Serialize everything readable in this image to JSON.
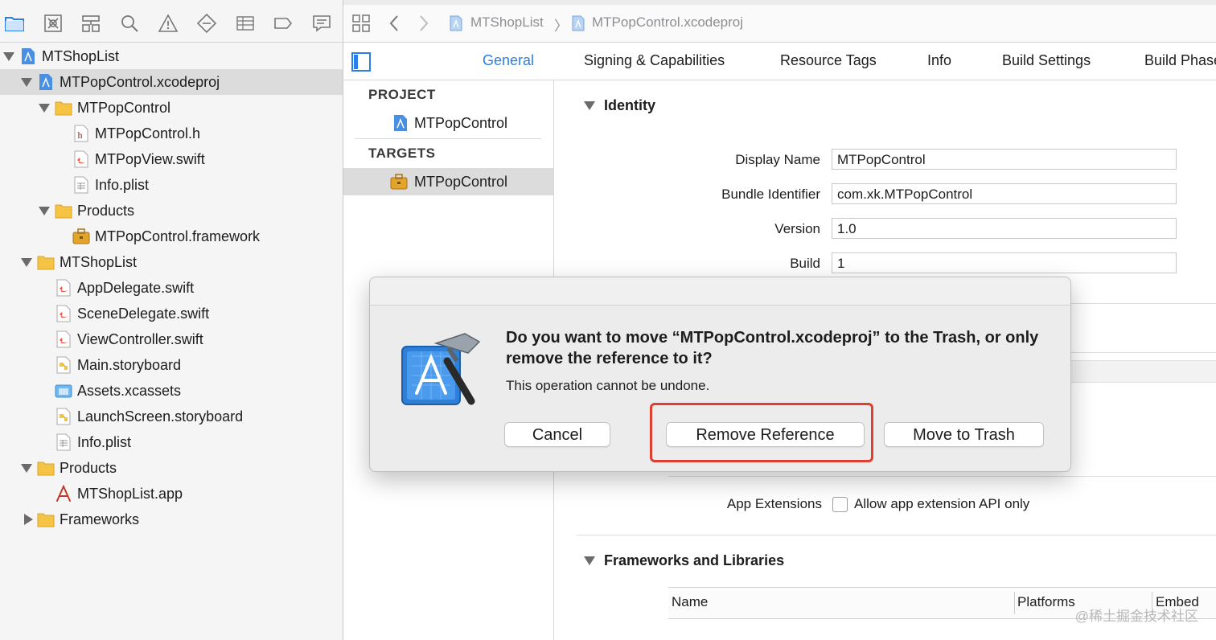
{
  "navigator": {
    "toolbar_icons": [
      "folder-icon",
      "source-control-icon",
      "symbol-icon",
      "find-icon",
      "issue-icon",
      "test-icon",
      "debug-icon",
      "breakpoint-icon",
      "report-icon"
    ],
    "tree": [
      {
        "label": "MTShopList",
        "icon": "project-icon",
        "depth": 0,
        "disclosure": "open",
        "selected": false
      },
      {
        "label": "MTPopControl.xcodeproj",
        "icon": "project-icon",
        "depth": 1,
        "disclosure": "open",
        "selected": true
      },
      {
        "label": "MTPopControl",
        "icon": "folder-icon",
        "depth": 2,
        "disclosure": "open",
        "selected": false
      },
      {
        "label": "MTPopControl.h",
        "icon": "header-file-icon",
        "depth": 3,
        "disclosure": "none",
        "selected": false
      },
      {
        "label": "MTPopView.swift",
        "icon": "swift-file-icon",
        "depth": 3,
        "disclosure": "none",
        "selected": false
      },
      {
        "label": "Info.plist",
        "icon": "plist-file-icon",
        "depth": 3,
        "disclosure": "none",
        "selected": false
      },
      {
        "label": "Products",
        "icon": "folder-icon",
        "depth": 2,
        "disclosure": "open",
        "selected": false
      },
      {
        "label": "MTPopControl.framework",
        "icon": "framework-icon",
        "depth": 3,
        "disclosure": "none",
        "selected": false
      },
      {
        "label": "MTShopList",
        "icon": "folder-icon",
        "depth": 1,
        "disclosure": "open",
        "selected": false
      },
      {
        "label": "AppDelegate.swift",
        "icon": "swift-file-icon",
        "depth": 2,
        "disclosure": "none",
        "selected": false
      },
      {
        "label": "SceneDelegate.swift",
        "icon": "swift-file-icon",
        "depth": 2,
        "disclosure": "none",
        "selected": false
      },
      {
        "label": "ViewController.swift",
        "icon": "swift-file-icon",
        "depth": 2,
        "disclosure": "none",
        "selected": false
      },
      {
        "label": "Main.storyboard",
        "icon": "storyboard-icon",
        "depth": 2,
        "disclosure": "none",
        "selected": false
      },
      {
        "label": "Assets.xcassets",
        "icon": "assets-icon",
        "depth": 2,
        "disclosure": "none",
        "selected": false
      },
      {
        "label": "LaunchScreen.storyboard",
        "icon": "storyboard-icon",
        "depth": 2,
        "disclosure": "none",
        "selected": false
      },
      {
        "label": "Info.plist",
        "icon": "plist-file-icon",
        "depth": 2,
        "disclosure": "none",
        "selected": false
      },
      {
        "label": "Products",
        "icon": "folder-icon",
        "depth": 1,
        "disclosure": "open",
        "selected": false
      },
      {
        "label": "MTShopList.app",
        "icon": "app-icon",
        "depth": 2,
        "disclosure": "none",
        "selected": false
      },
      {
        "label": "Frameworks",
        "icon": "folder-icon",
        "depth": 1,
        "disclosure": "closed",
        "selected": false
      }
    ]
  },
  "breadcrumb": {
    "project": "MTShopList",
    "separator": "〉",
    "file": "MTPopControl.xcodeproj"
  },
  "tabs": [
    {
      "label": "General",
      "active": true
    },
    {
      "label": "Signing & Capabilities",
      "active": false
    },
    {
      "label": "Resource Tags",
      "active": false
    },
    {
      "label": "Info",
      "active": false
    },
    {
      "label": "Build Settings",
      "active": false
    },
    {
      "label": "Build Phases",
      "active": false
    }
  ],
  "target_list": {
    "project_header": "PROJECT",
    "project_item": "MTPopControl",
    "targets_header": "TARGETS",
    "target_item": "MTPopControl"
  },
  "identity": {
    "title": "Identity",
    "fields": [
      {
        "label": "Display Name",
        "value": "MTPopControl"
      },
      {
        "label": "Bundle Identifier",
        "value": "com.xk.MTPopControl"
      },
      {
        "label": "Version",
        "value": "1.0"
      },
      {
        "label": "Build",
        "value": "1"
      }
    ]
  },
  "app_extensions": {
    "label": "App Extensions",
    "checkbox_label": "Allow app extension API only",
    "checked": false
  },
  "frameworks": {
    "title": "Frameworks and Libraries",
    "columns": [
      "Name",
      "Platforms",
      "Embed"
    ]
  },
  "dialog": {
    "message": "Do you want to move “MTPopControl.xcodeproj” to the Trash, or only remove the reference to it?",
    "info": "This operation cannot be undone.",
    "buttons": {
      "cancel": "Cancel",
      "remove_reference": "Remove Reference",
      "move_to_trash": "Move to Trash"
    },
    "highlight_color": "#e03e2f"
  },
  "colors": {
    "accent": "#2b7de9",
    "folder": "#f5c445",
    "selection": "#dcdcdc"
  },
  "watermark": "@稀土掘金技术社区"
}
